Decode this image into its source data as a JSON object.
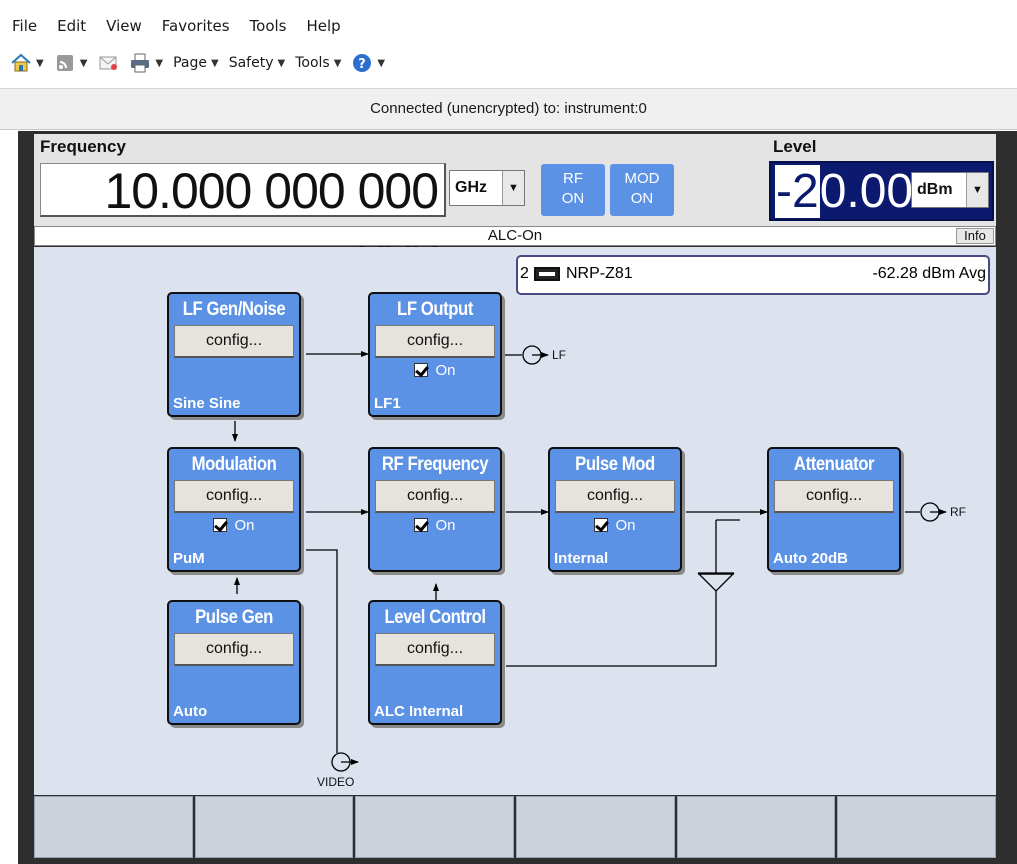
{
  "menu": [
    "File",
    "Edit",
    "View",
    "Favorites",
    "Tools",
    "Help"
  ],
  "commandbar": {
    "page": "Page",
    "safety": "Safety",
    "tools": "Tools"
  },
  "connection_status": "Connected (unencrypted) to: instrument:0",
  "frequency": {
    "label": "Frequency",
    "value": "10.000 000 000 000",
    "unit": "GHz"
  },
  "rf_button": {
    "line1": "RF",
    "line2": "ON"
  },
  "mod_button": {
    "line1": "MOD",
    "line2": "ON"
  },
  "level": {
    "label": "Level",
    "value_hl": "-2",
    "value_rest": "0.00",
    "unit": "dBm"
  },
  "alc_status": "ALC-On",
  "info_button": "Info",
  "sensor": {
    "index": "2",
    "name": "NRP-Z81",
    "value": "-62.28 dBm Avg"
  },
  "blocks": {
    "lf_gen": {
      "title": "LF Gen/Noise",
      "config": "config...",
      "status": "Sine Sine"
    },
    "lf_output": {
      "title": "LF Output",
      "config": "config...",
      "on": "On",
      "status": "LF1"
    },
    "modulation": {
      "title": "Modulation",
      "config": "config...",
      "on": "On",
      "status": "PuM"
    },
    "rf_frequency": {
      "title": "RF Frequency",
      "config": "config...",
      "on": "On",
      "status": ""
    },
    "pulse_mod": {
      "title": "Pulse Mod",
      "config": "config...",
      "on": "On",
      "status": "Internal"
    },
    "attenuator": {
      "title": "Attenuator",
      "config": "config...",
      "status": "Auto  20dB"
    },
    "pulse_gen": {
      "title": "Pulse Gen",
      "config": "config...",
      "status": "Auto"
    },
    "level_control": {
      "title": "Level Control",
      "config": "config...",
      "status": "ALC Internal"
    }
  },
  "ports": {
    "lf": "LF",
    "rf": "RF",
    "video": "VIDEO"
  },
  "softkeys": [
    "",
    "",
    "",
    "",
    "",
    ""
  ]
}
